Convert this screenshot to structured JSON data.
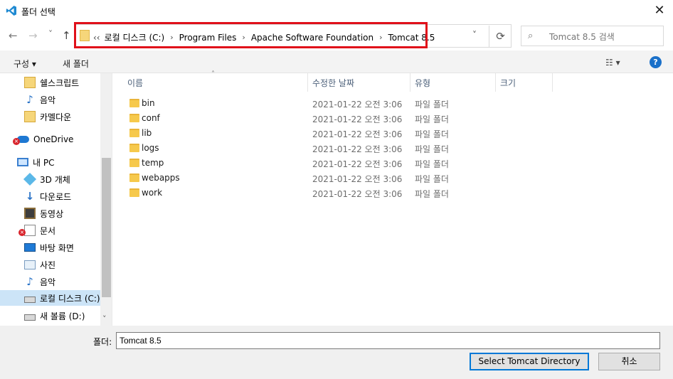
{
  "window": {
    "title": "폴더 선택",
    "close_glyph": "✕"
  },
  "nav": {
    "back": "←",
    "forward": "→",
    "recent": "˅",
    "up": "↑",
    "dropdown": "˅",
    "refresh": "⟳"
  },
  "address": {
    "overflow": "‹‹",
    "crumbs": [
      "로컬 디스크 (C:)",
      "Program Files",
      "Apache Software Foundation",
      "Tomcat 8.5"
    ],
    "sep": "›"
  },
  "search": {
    "placeholder": "Tomcat 8.5 검색",
    "icon": "⌕"
  },
  "toolbar": {
    "organize": "구성 ▾",
    "new_folder": "새 폴더",
    "view": "☷ ▾",
    "help": "?"
  },
  "sidebar": {
    "items": [
      {
        "label": "쉘스크립트",
        "icon": "folder-sync-icon"
      },
      {
        "label": "음악",
        "icon": "music-icon"
      },
      {
        "label": "카멜다운",
        "icon": "folder-sync-icon"
      },
      {
        "label": "OneDrive",
        "icon": "onedrive-icon"
      },
      {
        "label": "내 PC",
        "icon": "pc-icon"
      },
      {
        "label": "3D 개체",
        "icon": "3d-icon"
      },
      {
        "label": "다운로드",
        "icon": "download-icon"
      },
      {
        "label": "동영상",
        "icon": "video-icon"
      },
      {
        "label": "문서",
        "icon": "document-icon"
      },
      {
        "label": "바탕 화면",
        "icon": "desktop-icon"
      },
      {
        "label": "사진",
        "icon": "picture-icon"
      },
      {
        "label": "음악",
        "icon": "music-icon"
      },
      {
        "label": "로컬 디스크 (C:)",
        "icon": "drive-icon"
      },
      {
        "label": "새 볼륨 (D:)",
        "icon": "drive-icon"
      }
    ],
    "scroll_down": "˅"
  },
  "columns": {
    "name": "이름",
    "date": "수정한 날짜",
    "type": "유형",
    "size": "크기",
    "sort_arrow": "˄"
  },
  "files": [
    {
      "name": "bin",
      "date": "2021-01-22 오전 3:06",
      "type": "파일 폴더"
    },
    {
      "name": "conf",
      "date": "2021-01-22 오전 3:06",
      "type": "파일 폴더"
    },
    {
      "name": "lib",
      "date": "2021-01-22 오전 3:06",
      "type": "파일 폴더"
    },
    {
      "name": "logs",
      "date": "2021-01-22 오전 3:06",
      "type": "파일 폴더"
    },
    {
      "name": "temp",
      "date": "2021-01-22 오전 3:06",
      "type": "파일 폴더"
    },
    {
      "name": "webapps",
      "date": "2021-01-22 오전 3:06",
      "type": "파일 폴더"
    },
    {
      "name": "work",
      "date": "2021-01-22 오전 3:06",
      "type": "파일 폴더"
    }
  ],
  "footer": {
    "folder_label": "폴더:",
    "folder_value": "Tomcat 8.5",
    "select_button": "Select Tomcat Directory",
    "cancel_button": "취소"
  }
}
